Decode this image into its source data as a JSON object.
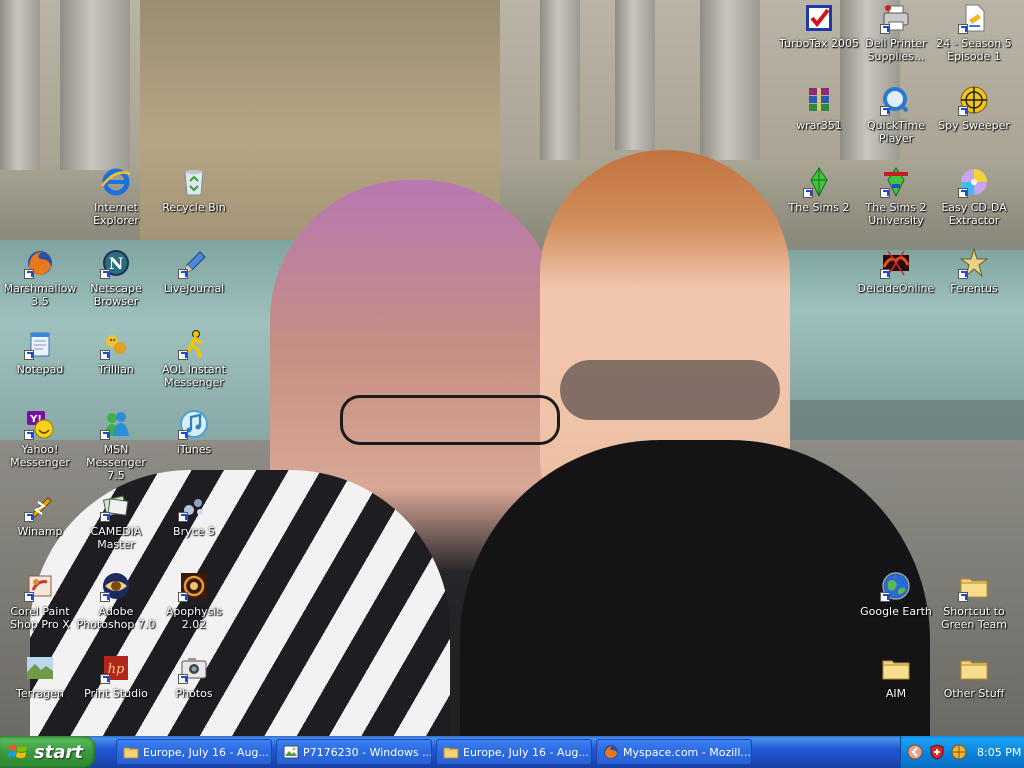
{
  "desktop_icons": [
    {
      "id": "internet-explorer",
      "label": "Internet Explorer",
      "icon": "internet-explorer-icon"
    },
    {
      "id": "recycle-bin",
      "label": "Recycle Bin",
      "icon": "recycle-bin-icon"
    },
    {
      "id": "marshmallow",
      "label": "Marshmallow 3.5",
      "icon": "firefox-icon"
    },
    {
      "id": "netscape",
      "label": "Netscape Browser",
      "icon": "netscape-icon"
    },
    {
      "id": "livejournal",
      "label": "LiveJournal",
      "icon": "pencil-icon"
    },
    {
      "id": "notepad",
      "label": "Notepad",
      "icon": "notepad-icon"
    },
    {
      "id": "trillian",
      "label": "Trillian",
      "icon": "trillian-icon"
    },
    {
      "id": "aim",
      "label": "AOL Instant Messenger",
      "icon": "aim-running-man-icon"
    },
    {
      "id": "yahoo",
      "label": "Yahoo! Messenger",
      "icon": "yahoo-smiley-icon"
    },
    {
      "id": "msn",
      "label": "MSN Messenger 7.5",
      "icon": "msn-buddy-icon"
    },
    {
      "id": "itunes",
      "label": "iTunes",
      "icon": "itunes-note-icon"
    },
    {
      "id": "winamp",
      "label": "Winamp",
      "icon": "winamp-bolt-icon"
    },
    {
      "id": "camedia",
      "label": "CAMEDIA Master",
      "icon": "camedia-icon"
    },
    {
      "id": "bryce",
      "label": "Bryce 5",
      "icon": "bryce-spheres-icon"
    },
    {
      "id": "corel",
      "label": "Corel Paint Shop Pro X",
      "icon": "corel-paint-icon"
    },
    {
      "id": "photoshop",
      "label": "Adobe Photoshop 7.0",
      "icon": "photoshop-eye-icon"
    },
    {
      "id": "apophysis",
      "label": "Apophysis 2.02",
      "icon": "apophysis-fractal-icon"
    },
    {
      "id": "terragen",
      "label": "Terragen",
      "icon": "terragen-landscape-icon"
    },
    {
      "id": "printstudio",
      "label": "Print Studio",
      "icon": "print-studio-icon"
    },
    {
      "id": "photos",
      "label": "Photos",
      "icon": "camera-icon"
    },
    {
      "id": "turbotax",
      "label": "TurboTax 2005",
      "icon": "turbotax-check-icon"
    },
    {
      "id": "dell",
      "label": "Dell Printer Supplies...",
      "icon": "printer-icon"
    },
    {
      "id": "24",
      "label": "24 - Season 5 Episode 1",
      "icon": "video-file-icon"
    },
    {
      "id": "wrar",
      "label": "wrar351",
      "icon": "winrar-books-icon"
    },
    {
      "id": "quicktime",
      "label": "QuickTime Player",
      "icon": "quicktime-icon"
    },
    {
      "id": "spysweeper",
      "label": "Spy Sweeper",
      "icon": "spy-sweeper-target-icon"
    },
    {
      "id": "sims2",
      "label": "The Sims 2",
      "icon": "sims-plumbob-icon"
    },
    {
      "id": "sims2uni",
      "label": "The Sims 2 University",
      "icon": "sims-university-icon"
    },
    {
      "id": "easycdda",
      "label": "Easy CD-DA Extractor",
      "icon": "cd-disc-icon"
    },
    {
      "id": "deicide",
      "label": "DeicideOnline",
      "icon": "deicide-game-icon"
    },
    {
      "id": "ferentus",
      "label": "Ferentus",
      "icon": "ferentus-star-icon"
    },
    {
      "id": "googleearth",
      "label": "Google Earth",
      "icon": "globe-icon"
    },
    {
      "id": "greenteam",
      "label": "Shortcut to Green Team",
      "icon": "folder-icon"
    },
    {
      "id": "aimfolder",
      "label": "AIM",
      "icon": "folder-icon"
    },
    {
      "id": "otherstuff",
      "label": "Other Stuff",
      "icon": "folder-icon"
    }
  ],
  "taskbar": {
    "start_label": "start",
    "tasks": [
      {
        "label": "Europe, July 16 - Aug...",
        "icon": "folder-icon"
      },
      {
        "label": "P7176230 - Windows ...",
        "icon": "picture-viewer-icon"
      },
      {
        "label": "Europe, July 16 - Aug...",
        "icon": "folder-icon"
      },
      {
        "label": "Myspace.com - Mozill...",
        "icon": "firefox-icon"
      }
    ],
    "tray_icons": [
      "chevron-left-icon",
      "security-shield-icon",
      "network-globe-icon"
    ],
    "clock": "8:05 PM"
  },
  "colors": {
    "taskbar_blue": "#245edb",
    "start_green": "#3a9a3d",
    "tray_blue": "#0f8be8"
  }
}
